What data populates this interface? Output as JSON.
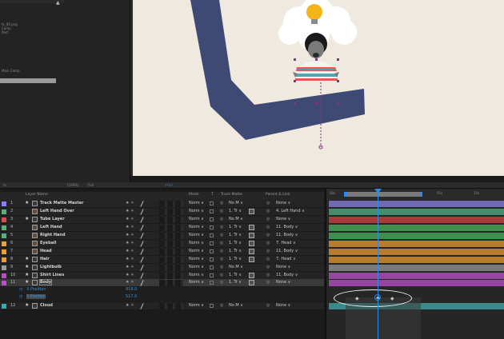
{
  "project_panel": {
    "lines": [
      "fx_00.png",
      "Comp",
      "Rect"
    ],
    "comp_label": "Main Comp"
  },
  "viewer_toolbar": {
    "zoom": "(100%)",
    "resolution": "Full",
    "frame": "+0.0"
  },
  "layer_header": {
    "layer_name": "Layer Name",
    "mode": "Mode",
    "t": "T",
    "track_matte": "Track Matte",
    "parent_link": "Parent & Link"
  },
  "layers": [
    {
      "num": "1",
      "name": "Track Matte Master",
      "color": "#8a7cff",
      "icon": "star",
      "mode": "Norm",
      "tm": "No M",
      "parent": "None",
      "bar": "#6e6bb3"
    },
    {
      "num": "2",
      "name": "Left Hand Over",
      "color": "#57b27a",
      "icon": "image",
      "mode": "Norm",
      "tm": "1. Tr",
      "parent": "4. Left Hand",
      "bar": "#3f8f6a"
    },
    {
      "num": "3",
      "name": "Tube Layer",
      "color": "#d64f4f",
      "icon": "star",
      "mode": "Norm",
      "tm": "No M",
      "parent": "None",
      "bar": "#a83a3a"
    },
    {
      "num": "4",
      "name": "Left Hand",
      "color": "#57b27a",
      "icon": "image",
      "mode": "Norm",
      "tm": "1. Tr",
      "parent": "11. Body",
      "bar": "#3f8f4f"
    },
    {
      "num": "5",
      "name": "Right Hand",
      "color": "#57b27a",
      "icon": "image",
      "mode": "Norm",
      "tm": "1. Tr",
      "parent": "11. Body",
      "bar": "#3f8f4f"
    },
    {
      "num": "6",
      "name": "Eyeball",
      "color": "#e8a03a",
      "icon": "image",
      "mode": "Norm",
      "tm": "1. Tr",
      "parent": "7. Head",
      "bar": "#b87d2c"
    },
    {
      "num": "7",
      "name": "Head",
      "color": "#e8a03a",
      "icon": "image",
      "mode": "Norm",
      "tm": "1. Tr",
      "parent": "11. Body",
      "bar": "#b87d2c"
    },
    {
      "num": "8",
      "name": "Hair",
      "color": "#e8a03a",
      "icon": "star",
      "mode": "Norm",
      "tm": "1. Tr",
      "parent": "7. Head",
      "bar": "#b87d2c"
    },
    {
      "num": "9",
      "name": "Lightbulb",
      "color": "#9a9a9a",
      "icon": "star",
      "mode": "Norm",
      "tm": "No M",
      "parent": "None",
      "bar": "#7a7a7a"
    },
    {
      "num": "10",
      "name": "Shirt Lines",
      "color": "#b84fc4",
      "icon": "star",
      "mode": "Norm",
      "tm": "1. Tr",
      "parent": "11. Body",
      "bar": "#9446a0"
    },
    {
      "num": "11",
      "name": "Body",
      "color": "#b84fc4",
      "icon": "star",
      "mode": "Norm",
      "tm": "1. Tr",
      "parent": "None",
      "bar": "#9446a0",
      "selected": true
    },
    {
      "num": "12",
      "name": "Cloud",
      "color": "#3fa9a9",
      "icon": "star",
      "mode": "Norm",
      "tm": "No M",
      "parent": "None",
      "bar": "#3a8a8a"
    }
  ],
  "properties": [
    {
      "name": "X Position",
      "value": "918.0"
    },
    {
      "name": "Y Position",
      "value": "517.0"
    }
  ],
  "timeline": {
    "ticks": [
      "00s",
      "05s",
      "10s"
    ]
  }
}
